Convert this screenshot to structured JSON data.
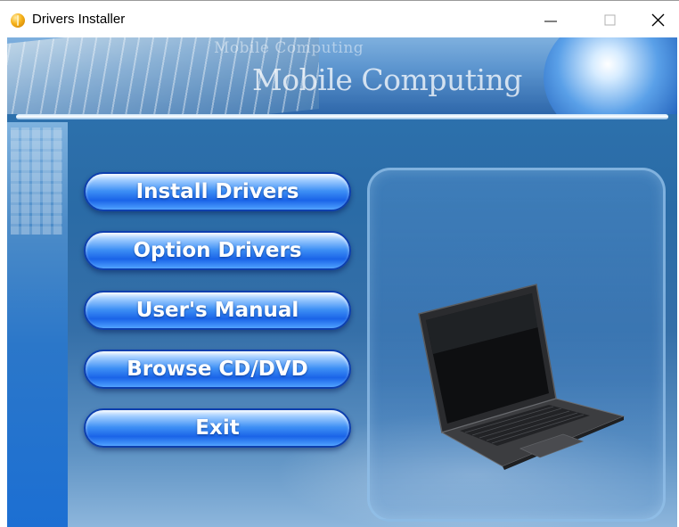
{
  "window": {
    "title": "Drivers Installer",
    "icon": "cd-icon"
  },
  "banner": {
    "logo_small": "Mobile Computing",
    "logo_big": "Mobile Computing"
  },
  "menu": {
    "install": "Install Drivers",
    "option": "Option Drivers",
    "manual": "User's Manual",
    "browse": "Browse CD/DVD",
    "exit": "Exit"
  },
  "colors": {
    "button_blue": "#1a64e8",
    "background_blue": "#2a6ba6"
  }
}
